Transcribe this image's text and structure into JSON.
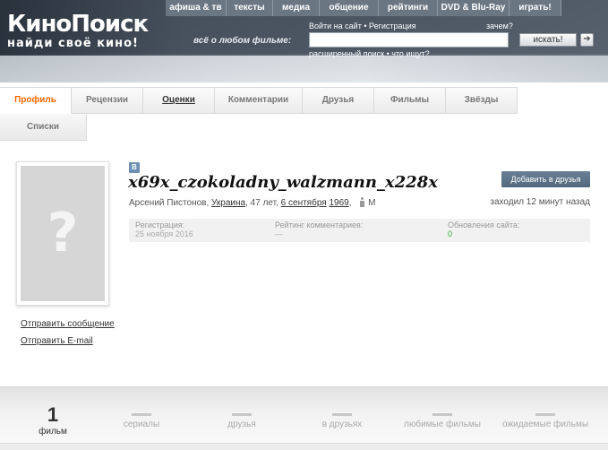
{
  "header": {
    "logo_name": "КиноПоиск",
    "logo_tagline": "найди своё кино!",
    "nav": [
      {
        "label": "афиша & тв"
      },
      {
        "label": "тексты"
      },
      {
        "label": "медиа"
      },
      {
        "label": "общение"
      },
      {
        "label": "рейтинги"
      },
      {
        "label": "DVD & Blu-Ray"
      },
      {
        "label": "играть!"
      }
    ],
    "search_label": "всё о любом фильме:",
    "login_link": "Войти на сайт",
    "register_link": "Регистрация",
    "why_link": "зачем?",
    "search_value": "",
    "search_button": "искать!",
    "go_icon": "arrow-right-icon",
    "advanced_search_link": "расширенный поиск",
    "what_searched_link": "что ищут?"
  },
  "tabs": [
    {
      "label": "Профиль",
      "active": true
    },
    {
      "label": "Рецензии"
    },
    {
      "label": "Оценки"
    },
    {
      "label": "Комментарии"
    },
    {
      "label": "Друзья"
    },
    {
      "label": "Фильмы"
    },
    {
      "label": "Звёзды"
    }
  ],
  "tabs_row2": [
    {
      "label": "Списки"
    }
  ],
  "profile": {
    "avatar_icon": "question-mark-icon",
    "avatar_glyph": "?",
    "send_message": "Отправить сообщение",
    "send_email": "Отправить E-mail",
    "vk_badge": "В",
    "nickname": "x69x_czokoladny_walzmann_x228x",
    "real_name": "Арсений Пистонов,",
    "country": "Украина",
    "age": ", 47 лет,",
    "birth_day": "6 сентября",
    "birth_year": "1969",
    "gender": "М",
    "add_friend_button": "Добавить в друзья",
    "last_seen": "заходил 12 минут назад"
  },
  "stats": [
    {
      "label": "Регистрация:",
      "value": "25 ноября 2016"
    },
    {
      "label": "Рейтинг комментариев:",
      "value": "—"
    },
    {
      "label": "Обновления сайта:",
      "value": "0"
    }
  ],
  "counters": [
    {
      "value": "1",
      "label": "фильм"
    },
    {
      "value": "",
      "label": "сериалы"
    },
    {
      "value": "",
      "label": "друзья"
    },
    {
      "value": "",
      "label": "в друзьях"
    },
    {
      "value": "",
      "label": "любимые фильмы"
    },
    {
      "value": "",
      "label": "ожидаемые фильмы"
    }
  ],
  "colors": {
    "active_tab": "#ff6600",
    "button_blue": "#5c7288",
    "green_value": "#33aa33"
  }
}
